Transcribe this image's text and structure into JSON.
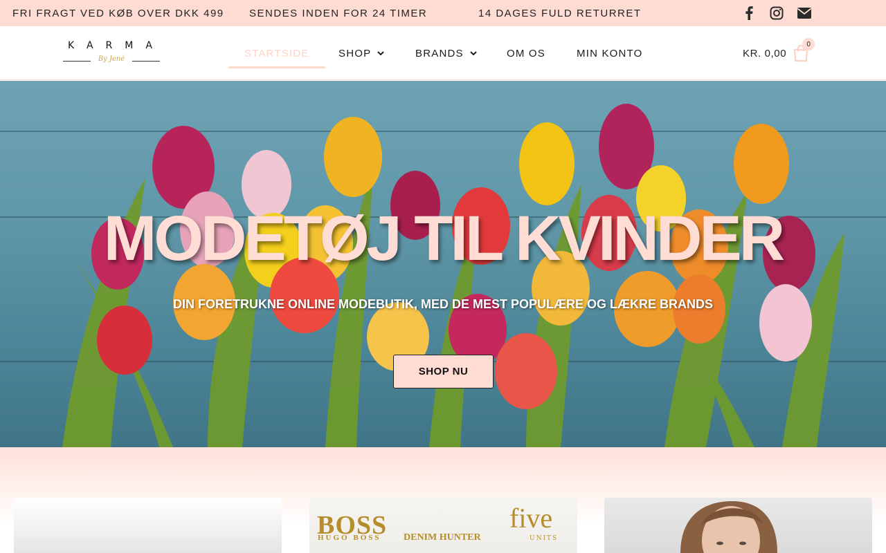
{
  "topbar": {
    "messages": [
      "FRI FRAGT VED KØB OVER DKK 499",
      "SENDES INDEN FOR 24 TIMER",
      "14 DAGES FULD RETURRET"
    ],
    "social": [
      "facebook-icon",
      "instagram-icon",
      "envelope-icon"
    ]
  },
  "header": {
    "logo": {
      "text": "KARMA",
      "sub": "By Jené"
    },
    "nav": [
      {
        "label": "STARTSIDE",
        "active": true
      },
      {
        "label": "SHOP",
        "dropdown": true
      },
      {
        "label": "BRANDS",
        "dropdown": true
      },
      {
        "label": "OM OS"
      },
      {
        "label": "MIN KONTO"
      }
    ],
    "cart": {
      "total": "KR. 0,00",
      "count": "0"
    }
  },
  "hero": {
    "title": "MODETØJ TIL KVINDER",
    "subtitle": "DIN FORETRUKNE ONLINE MODEBUTIK, MED DE MEST POPULÆRE OG LÆKRE BRANDS",
    "button": "SHOP NU"
  },
  "brands": {
    "boss": "BOSS",
    "hugo": "HUGO BOSS",
    "denim": "DENIM HUNTER",
    "five": "five",
    "units": "UNITS"
  },
  "colors": {
    "accent": "#ffdcd3",
    "text": "#1a1a1a",
    "hero_blue": "#5f97a8",
    "gold": "#b58d2c"
  }
}
